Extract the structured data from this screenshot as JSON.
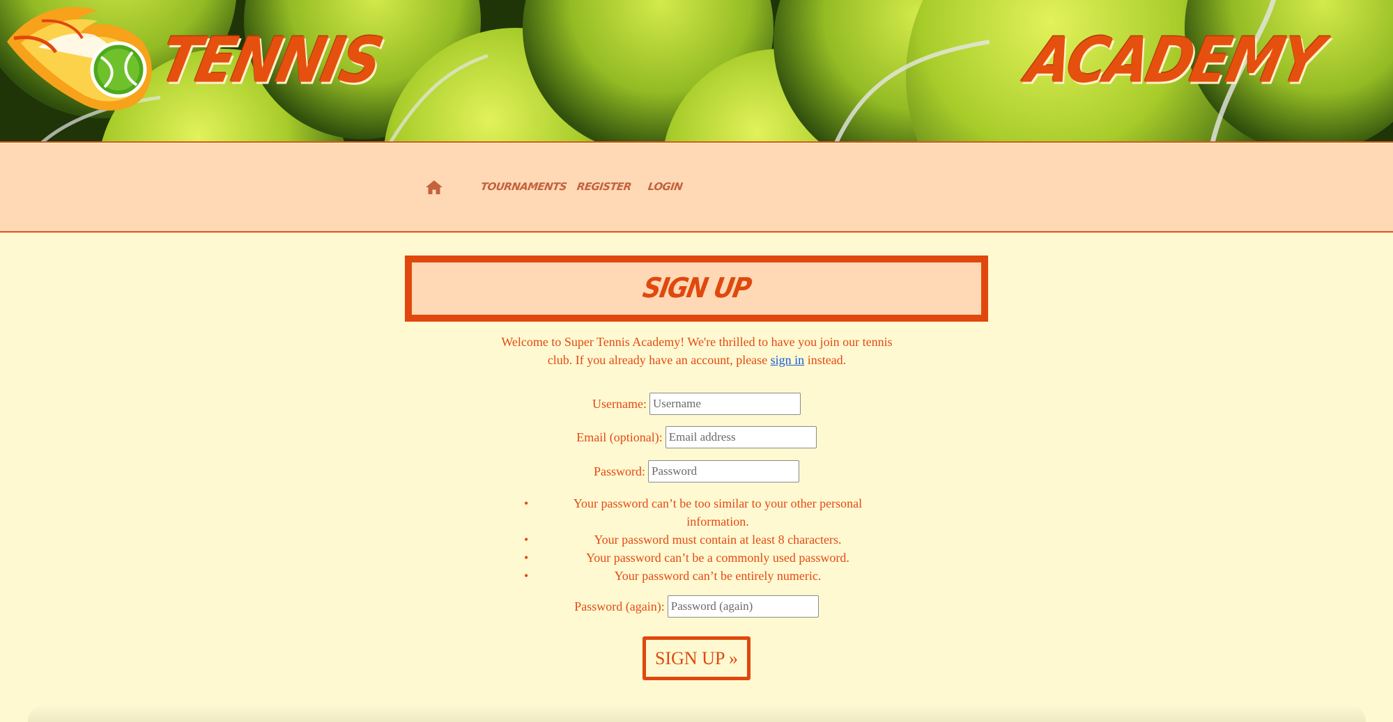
{
  "header": {
    "left_word": "TENNIS",
    "right_word": "ACADEMY",
    "logo_icon": "flaming-tennis-ball-logo"
  },
  "nav": {
    "home_icon": "home-icon",
    "items": [
      {
        "label": "TOURNAMENTS"
      },
      {
        "label": "REGISTER"
      },
      {
        "label": "LOGIN"
      }
    ]
  },
  "signup": {
    "title": "SIGN UP",
    "intro_before": "Welcome to Super Tennis Academy! We're thrilled to have you join our tennis club. If you already have an account, please",
    "intro_link": "sign in",
    "intro_after": "instead.",
    "fields": {
      "username": {
        "label": "Username:",
        "placeholder": "Username",
        "value": ""
      },
      "email": {
        "label": "Email (optional):",
        "placeholder": "Email address",
        "value": ""
      },
      "password": {
        "label": "Password:",
        "placeholder": "Password",
        "value": ""
      },
      "password2": {
        "label": "Password (again):",
        "placeholder": "Password (again)",
        "value": ""
      }
    },
    "password_rules": [
      "Your password can’t be too similar to your other personal information.",
      "Your password must contain at least 8 characters.",
      "Your password can’t be a commonly used password.",
      "Your password can’t be entirely numeric."
    ],
    "submit_label": "SIGN UP »"
  },
  "colors": {
    "accent": "#e0480d",
    "page_bg": "#fff9d2",
    "nav_bg": "#ffd9b6",
    "link": "#1a5bd6"
  }
}
